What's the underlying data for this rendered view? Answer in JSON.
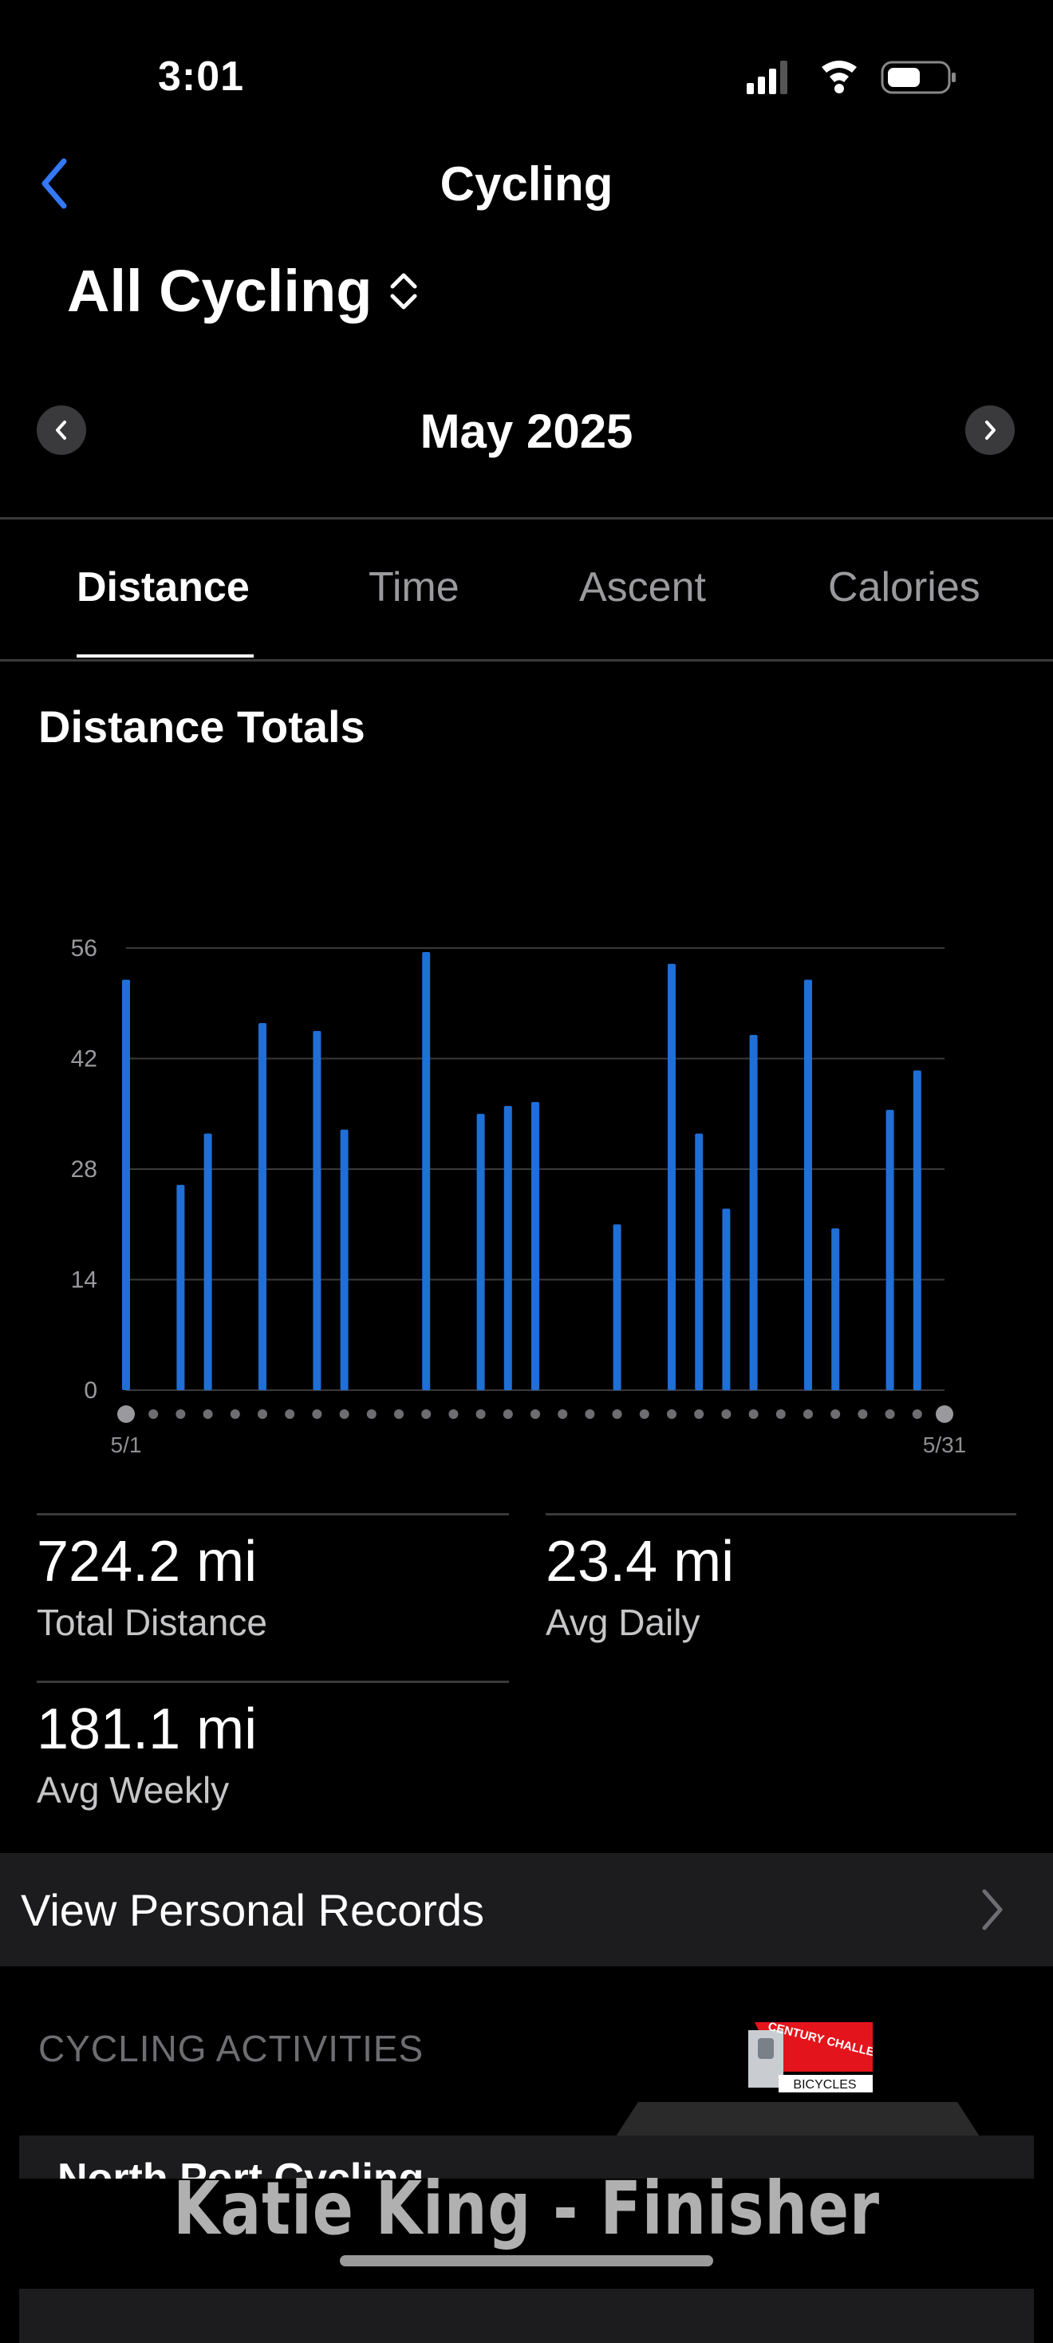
{
  "status_bar": {
    "time": "3:01"
  },
  "nav": {
    "title": "Cycling"
  },
  "selector": {
    "label": "All Cycling"
  },
  "month": {
    "label": "May 2025"
  },
  "tabs": [
    {
      "label": "Distance",
      "active": true
    },
    {
      "label": "Time",
      "active": false
    },
    {
      "label": "Ascent",
      "active": false
    },
    {
      "label": "Calories",
      "active": false
    }
  ],
  "section": {
    "title": "Distance Totals"
  },
  "chart_data": {
    "type": "bar",
    "title": "Distance Totals",
    "xlabel": "",
    "ylabel": "",
    "x_tick_labels": [
      "5/1",
      "5/31"
    ],
    "y_ticks": [
      "0",
      "14",
      "28",
      "42",
      "56"
    ],
    "ylim": [
      0,
      56
    ],
    "grid": true,
    "bar_color": "#1f6fd6",
    "categories": [
      "5/1",
      "5/2",
      "5/3",
      "5/4",
      "5/5",
      "5/6",
      "5/7",
      "5/8",
      "5/9",
      "5/10",
      "5/11",
      "5/12",
      "5/13",
      "5/14",
      "5/15",
      "5/16",
      "5/17",
      "5/18",
      "5/19",
      "5/20",
      "5/21",
      "5/22",
      "5/23",
      "5/24",
      "5/25",
      "5/26",
      "5/27",
      "5/28",
      "5/29",
      "5/30",
      "5/31"
    ],
    "values": [
      52,
      0,
      26,
      32.5,
      0,
      46.5,
      0,
      45.5,
      33,
      0,
      0,
      55.5,
      0,
      35,
      36,
      36.5,
      0,
      0,
      21,
      0,
      54,
      32.5,
      23,
      45,
      0,
      52,
      20.5,
      0,
      35.5,
      40.5,
      0
    ]
  },
  "stats": {
    "total_distance": {
      "value": "724.2 mi",
      "label": "Total Distance"
    },
    "avg_daily": {
      "value": "23.4 mi",
      "label": "Avg Daily"
    },
    "avg_weekly": {
      "value": "181.1 mi",
      "label": "Avg Weekly"
    }
  },
  "records": {
    "label": "View Personal Records"
  },
  "activities": {
    "header": "CYCLING ACTIVITIES",
    "first_title": "North Port Cycling"
  },
  "promo": {
    "line1": "CENTURY CHALLENGE",
    "line2": "BICYCLES"
  },
  "footer": {
    "text": "Katie King - Finisher"
  },
  "colors": {
    "accent": "#3478f6",
    "bar": "#1f6fd6",
    "background": "#000000"
  }
}
